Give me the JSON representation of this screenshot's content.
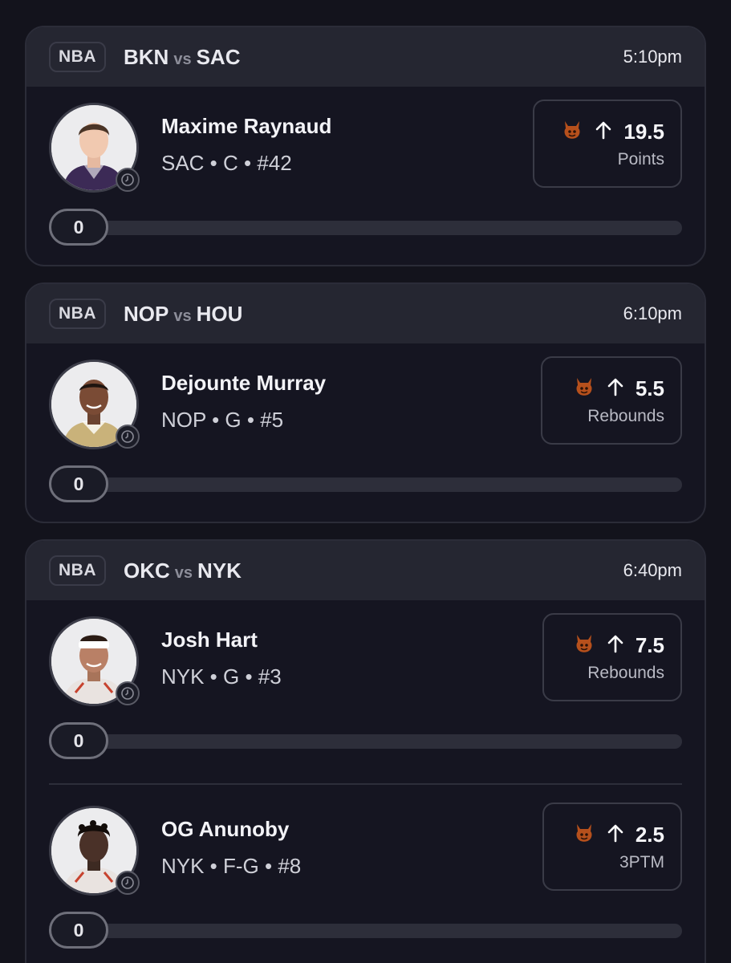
{
  "colors": {
    "background": "#13131c",
    "card_header": "#252631",
    "card_body": "#151521",
    "border": "#2b2c38",
    "devil_icon": "#b6501c"
  },
  "cards": [
    {
      "league": "NBA",
      "home": "BKN",
      "vs": "vs",
      "away": "SAC",
      "time": "5:10pm",
      "players": [
        {
          "name": "Maxime Raynaud",
          "meta": "SAC • C • #42",
          "icon": "devil-icon",
          "direction_icon": "arrow-up-icon",
          "line": "19.5",
          "stat": "Points",
          "progress_value": "0",
          "jersey_color": "#3c2a56"
        }
      ]
    },
    {
      "league": "NBA",
      "home": "NOP",
      "vs": "vs",
      "away": "HOU",
      "time": "6:10pm",
      "players": [
        {
          "name": "Dejounte Murray",
          "meta": "NOP • G • #5",
          "icon": "devil-icon",
          "direction_icon": "arrow-up-icon",
          "line": "5.5",
          "stat": "Rebounds",
          "progress_value": "0",
          "jersey_color": "#c9b27a"
        }
      ]
    },
    {
      "league": "NBA",
      "home": "OKC",
      "vs": "vs",
      "away": "NYK",
      "time": "6:40pm",
      "players": [
        {
          "name": "Josh Hart",
          "meta": "NYK • G • #3",
          "icon": "devil-icon",
          "direction_icon": "arrow-up-icon",
          "line": "7.5",
          "stat": "Rebounds",
          "progress_value": "0",
          "jersey_color": "#e9e3e0"
        },
        {
          "name": "OG Anunoby",
          "meta": "NYK • F-G • #8",
          "icon": "devil-icon",
          "direction_icon": "arrow-up-icon",
          "line": "2.5",
          "stat": "3PTM",
          "progress_value": "0",
          "jersey_color": "#e9e3e0"
        }
      ]
    }
  ]
}
